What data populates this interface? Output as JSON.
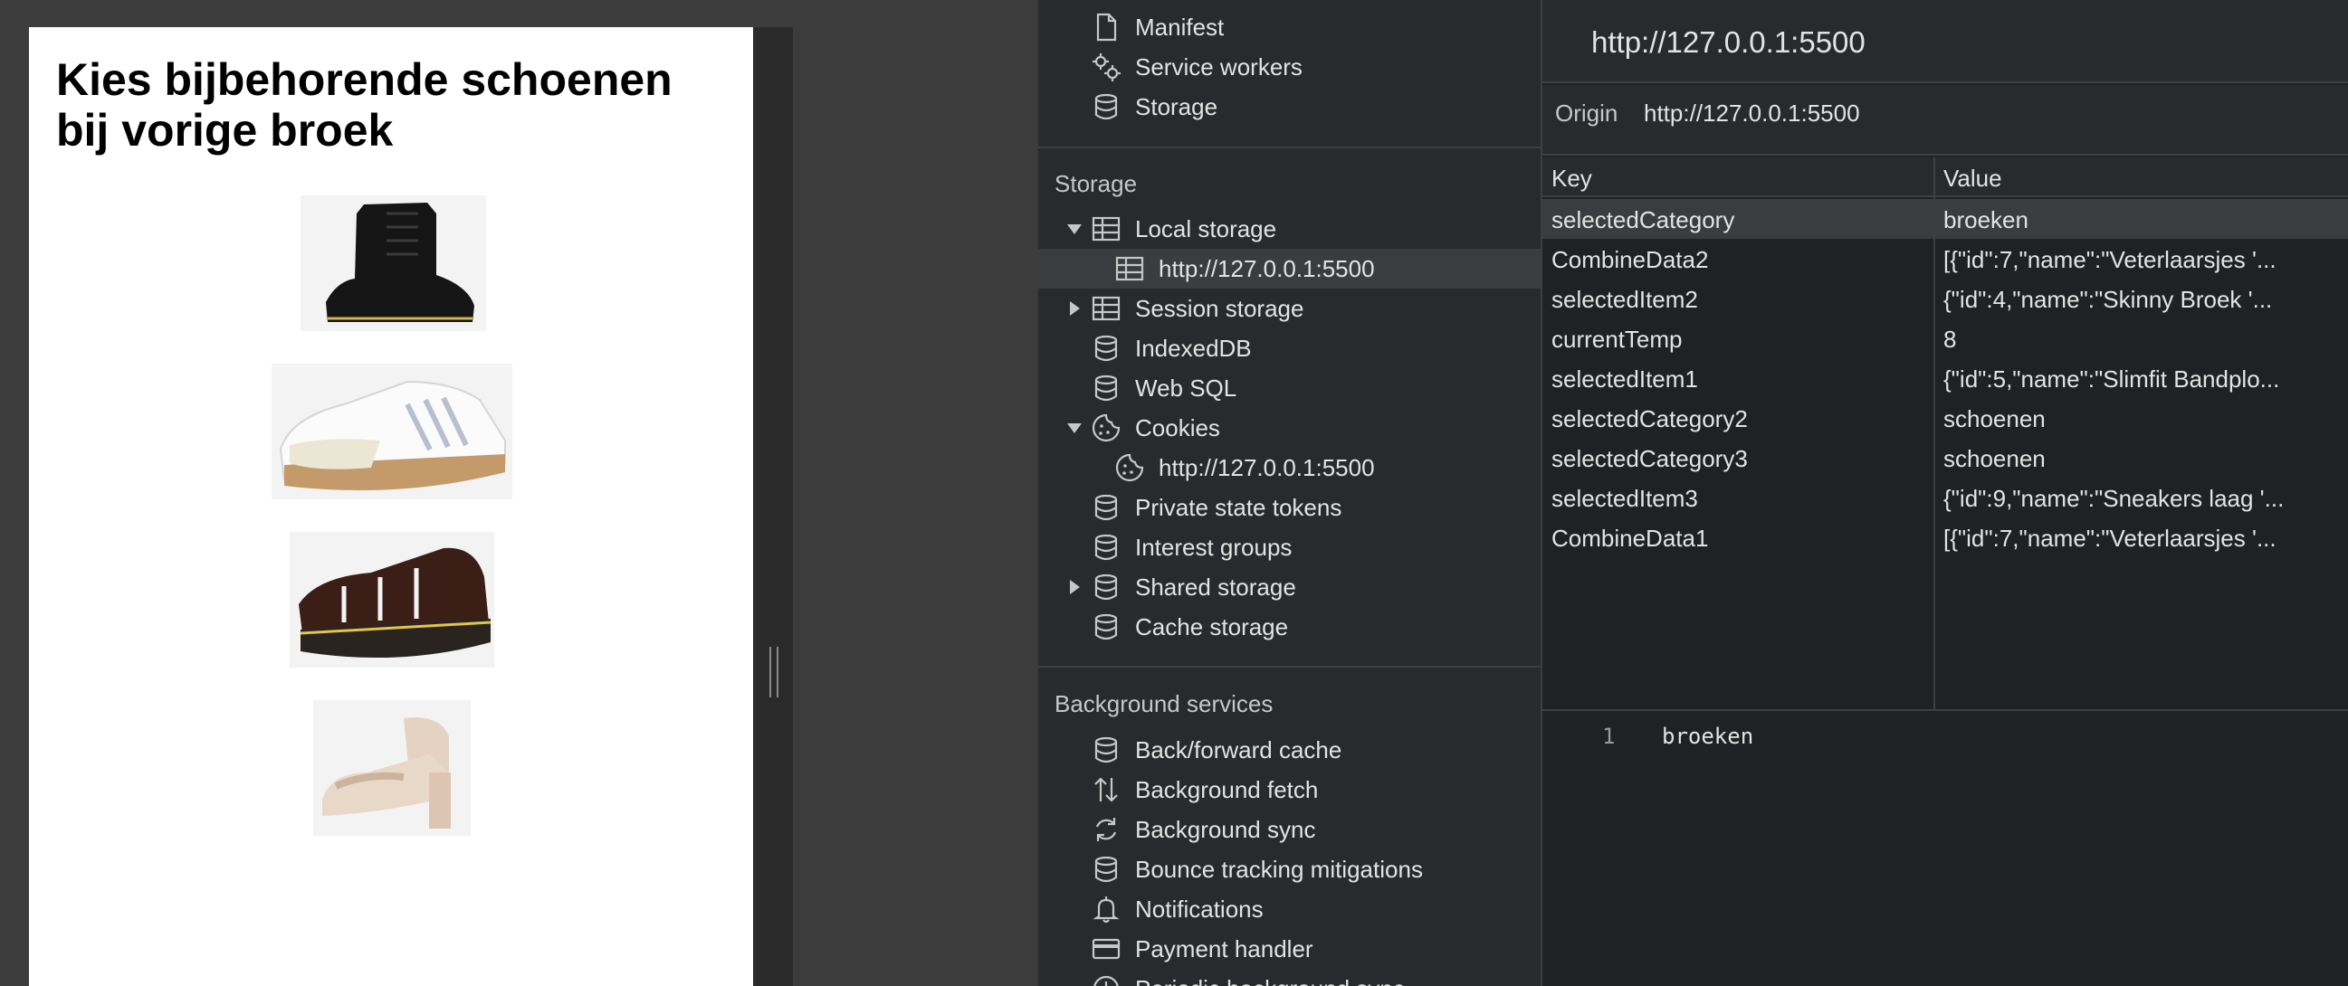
{
  "page": {
    "title": "Kies bijbehorende schoenen bij vorige broek"
  },
  "sidebar": {
    "top_items": [
      {
        "label": "Manifest",
        "icon": "file-icon"
      },
      {
        "label": "Service workers",
        "icon": "gears-icon"
      },
      {
        "label": "Storage",
        "icon": "database-icon"
      }
    ],
    "storage_title": "Storage",
    "storage_items": [
      {
        "label": "Local storage",
        "icon": "table-icon"
      },
      {
        "label": "http://127.0.0.1:5500",
        "icon": "table-icon"
      },
      {
        "label": "Session storage",
        "icon": "table-icon"
      },
      {
        "label": "IndexedDB",
        "icon": "database-icon"
      },
      {
        "label": "Web SQL",
        "icon": "database-icon"
      },
      {
        "label": "Cookies",
        "icon": "cookie-icon"
      },
      {
        "label": "http://127.0.0.1:5500",
        "icon": "cookie-icon"
      },
      {
        "label": "Private state tokens",
        "icon": "database-icon"
      },
      {
        "label": "Interest groups",
        "icon": "database-icon"
      },
      {
        "label": "Shared storage",
        "icon": "database-icon"
      },
      {
        "label": "Cache storage",
        "icon": "database-icon"
      }
    ],
    "background_title": "Background services",
    "background_items": [
      {
        "label": "Back/forward cache",
        "icon": "database-icon"
      },
      {
        "label": "Background fetch",
        "icon": "up-down-arrows-icon"
      },
      {
        "label": "Background sync",
        "icon": "sync-icon"
      },
      {
        "label": "Bounce tracking mitigations",
        "icon": "database-icon"
      },
      {
        "label": "Notifications",
        "icon": "bell-icon"
      },
      {
        "label": "Payment handler",
        "icon": "credit-card-icon"
      },
      {
        "label": "Periodic background sync",
        "icon": "clock-icon"
      }
    ]
  },
  "panel": {
    "origin_title": "http://127.0.0.1:5500",
    "origin_label": "Origin",
    "origin_value": "http://127.0.0.1:5500",
    "columns": {
      "key": "Key",
      "value": "Value"
    },
    "rows": [
      {
        "key": "selectedCategory",
        "value": "broeken"
      },
      {
        "key": "CombineData2",
        "value": "[{\"id\":7,\"name\":\"Veterlaarsjes '..."
      },
      {
        "key": "selectedItem2",
        "value": "{\"id\":4,\"name\":\"Skinny Broek '..."
      },
      {
        "key": "currentTemp",
        "value": "8"
      },
      {
        "key": "selectedItem1",
        "value": "{\"id\":5,\"name\":\"Slimfit Bandplo..."
      },
      {
        "key": "selectedCategory2",
        "value": "schoenen"
      },
      {
        "key": "selectedCategory3",
        "value": "schoenen"
      },
      {
        "key": "selectedItem3",
        "value": "{\"id\":9,\"name\":\"Sneakers laag '..."
      },
      {
        "key": "CombineData1",
        "value": "[{\"id\":7,\"name\":\"Veterlaarsjes '..."
      }
    ],
    "preview": {
      "line_number": "1",
      "content": "broeken"
    }
  }
}
